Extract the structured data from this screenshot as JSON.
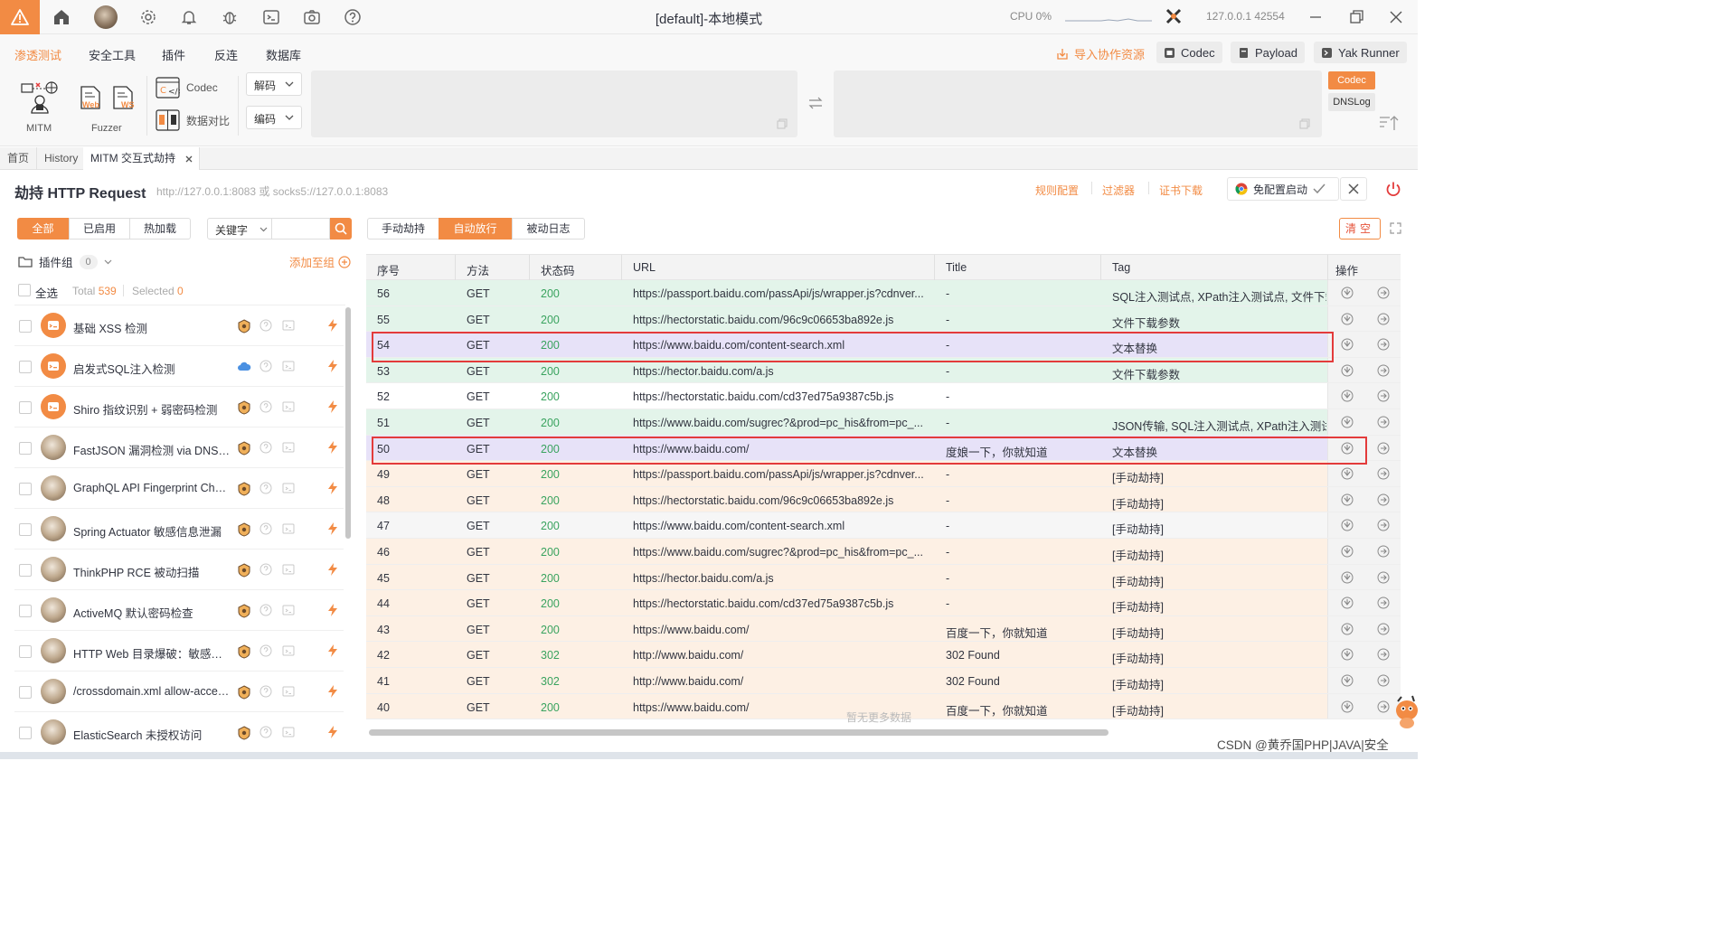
{
  "title": "[default]-本地模式",
  "status": {
    "cpu": "CPU 0%",
    "address": "127.0.0.1 42554"
  },
  "menu": [
    "渗透测试",
    "安全工具",
    "插件",
    "反连",
    "数据库"
  ],
  "top_buttons": {
    "import": "导入协作资源",
    "codec": "Codec",
    "payload": "Payload",
    "yak_runner": "Yak Runner"
  },
  "tools": {
    "mitm": "MITM",
    "fuzzer": "Fuzzer",
    "web": "Web",
    "ws": "WS",
    "codec": "Codec",
    "compare": "数据对比",
    "decode": "解码",
    "encode": "编码",
    "side_codec": "Codec",
    "side_dnslog": "DNSLog"
  },
  "tabs": [
    {
      "label": "首页"
    },
    {
      "label": "History"
    },
    {
      "label": "MITM 交互式劫持"
    }
  ],
  "header": {
    "title": "劫持 HTTP Request",
    "proxy": "http://127.0.0.1:8083 或 socks5://127.0.0.1:8083",
    "rules": "规则配置",
    "filter": "过滤器",
    "cert": "证书下载",
    "browser": "免配置启动"
  },
  "left": {
    "filters": [
      "全部",
      "已启用",
      "热加载"
    ],
    "keyword": "关键字",
    "group_label": "插件组",
    "group_count": "0",
    "add_group": "添加至组",
    "select_all": "全选",
    "total_label": "Total",
    "total": "539",
    "selected_label": "Selected",
    "selected": "0",
    "plugins": [
      {
        "name": "基础 XSS 检测",
        "avatar": "orange",
        "badge": "shield"
      },
      {
        "name": "启发式SQL注入检测",
        "avatar": "orange",
        "badge": "cloud"
      },
      {
        "name": "Shiro 指纹识别 + 弱密码检测",
        "avatar": "orange",
        "badge": "shield"
      },
      {
        "name": "FastJSON 漏洞检测 via DNSLog",
        "avatar": "photo",
        "badge": "shield"
      },
      {
        "name": "GraphQL API Fingerprint Chec...",
        "avatar": "photo",
        "badge": "shield"
      },
      {
        "name": "Spring Actuator 敏感信息泄漏",
        "avatar": "photo",
        "badge": "shield"
      },
      {
        "name": "ThinkPHP RCE 被动扫描",
        "avatar": "photo",
        "badge": "shield"
      },
      {
        "name": "ActiveMQ 默认密码检查",
        "avatar": "photo",
        "badge": "shield"
      },
      {
        "name": "HTTP Web 目录爆破：敏感中...",
        "avatar": "photo",
        "badge": "shield"
      },
      {
        "name": "/crossdomain.xml allow-acces...",
        "avatar": "photo",
        "badge": "shield"
      },
      {
        "name": "ElasticSearch 未授权访问",
        "avatar": "photo",
        "badge": "shield"
      }
    ]
  },
  "right": {
    "tabs": [
      "手动劫持",
      "自动放行",
      "被动日志"
    ],
    "clear": "清空",
    "columns": [
      "序号",
      "方法",
      "状态码",
      "URL",
      "Title",
      "Tag",
      "操作"
    ],
    "rows": [
      {
        "id": "56",
        "method": "GET",
        "status": "200",
        "url": "https://passport.baidu.com/passApi/js/wrapper.js?cdnver...",
        "title": "-",
        "tag": "SQL注入测试点, XPath注入测试点, 文件下载参",
        "bg": "#e3f4ea"
      },
      {
        "id": "55",
        "method": "GET",
        "status": "200",
        "url": "https://hectorstatic.baidu.com/96c9c06653ba892e.js",
        "title": "-",
        "tag": "文件下载参数",
        "bg": "#e3f4ea"
      },
      {
        "id": "54",
        "method": "GET",
        "status": "200",
        "url": "https://www.baidu.com/content-search.xml",
        "title": "-",
        "tag": "文本替换",
        "bg": "#e7e2f8"
      },
      {
        "id": "53",
        "method": "GET",
        "status": "200",
        "url": "https://hector.baidu.com/a.js",
        "title": "-",
        "tag": "文件下载参数",
        "bg": "#e3f4ea"
      },
      {
        "id": "52",
        "method": "GET",
        "status": "200",
        "url": "https://hectorstatic.baidu.com/cd37ed75a9387c5b.js",
        "title": "-",
        "tag": "",
        "bg": "#ffffff"
      },
      {
        "id": "51",
        "method": "GET",
        "status": "200",
        "url": "https://www.baidu.com/sugrec?&prod=pc_his&from=pc_...",
        "title": "-",
        "tag": "JSON传输, SQL注入测试点, XPath注入测试点",
        "bg": "#e3f4ea"
      },
      {
        "id": "50",
        "method": "GET",
        "status": "200",
        "url": "https://www.baidu.com/",
        "title": "度娘一下，你就知道",
        "tag": "文本替换",
        "bg": "#e7e2f8"
      },
      {
        "id": "49",
        "method": "GET",
        "status": "200",
        "url": "https://passport.baidu.com/passApi/js/wrapper.js?cdnver...",
        "title": "-",
        "tag": "[手动劫持]",
        "bg": "#fdf0e4"
      },
      {
        "id": "48",
        "method": "GET",
        "status": "200",
        "url": "https://hectorstatic.baidu.com/96c9c06653ba892e.js",
        "title": "-",
        "tag": "[手动劫持]",
        "bg": "#fdf0e4"
      },
      {
        "id": "47",
        "method": "GET",
        "status": "200",
        "url": "https://www.baidu.com/content-search.xml",
        "title": "-",
        "tag": "[手动劫持]",
        "bg": "#f6f6f6"
      },
      {
        "id": "46",
        "method": "GET",
        "status": "200",
        "url": "https://www.baidu.com/sugrec?&prod=pc_his&from=pc_...",
        "title": "-",
        "tag": "[手动劫持]",
        "bg": "#fdf0e4"
      },
      {
        "id": "45",
        "method": "GET",
        "status": "200",
        "url": "https://hector.baidu.com/a.js",
        "title": "-",
        "tag": "[手动劫持]",
        "bg": "#fdf0e4"
      },
      {
        "id": "44",
        "method": "GET",
        "status": "200",
        "url": "https://hectorstatic.baidu.com/cd37ed75a9387c5b.js",
        "title": "-",
        "tag": "[手动劫持]",
        "bg": "#fdf0e4"
      },
      {
        "id": "43",
        "method": "GET",
        "status": "200",
        "url": "https://www.baidu.com/",
        "title": "百度一下，你就知道",
        "tag": "[手动劫持]",
        "bg": "#fdf0e4"
      },
      {
        "id": "42",
        "method": "GET",
        "status": "302",
        "url": "http://www.baidu.com/",
        "title": "302 Found",
        "tag": "[手动劫持]",
        "bg": "#fdf0e4"
      },
      {
        "id": "41",
        "method": "GET",
        "status": "302",
        "url": "http://www.baidu.com/",
        "title": "302 Found",
        "tag": "[手动劫持]",
        "bg": "#fdf0e4"
      },
      {
        "id": "40",
        "method": "GET",
        "status": "200",
        "url": "https://www.baidu.com/",
        "title": "百度一下，你就知道",
        "tag": "[手动劫持]",
        "bg": "#fdf0e4"
      }
    ],
    "no_more": "暂无更多数据"
  },
  "footer": "CSDN @黄乔国PHP|JAVA|安全",
  "colors": {
    "accent": "#f28b44",
    "status_ok": "#3aa35f",
    "highlight_border": "#e33b3b"
  }
}
